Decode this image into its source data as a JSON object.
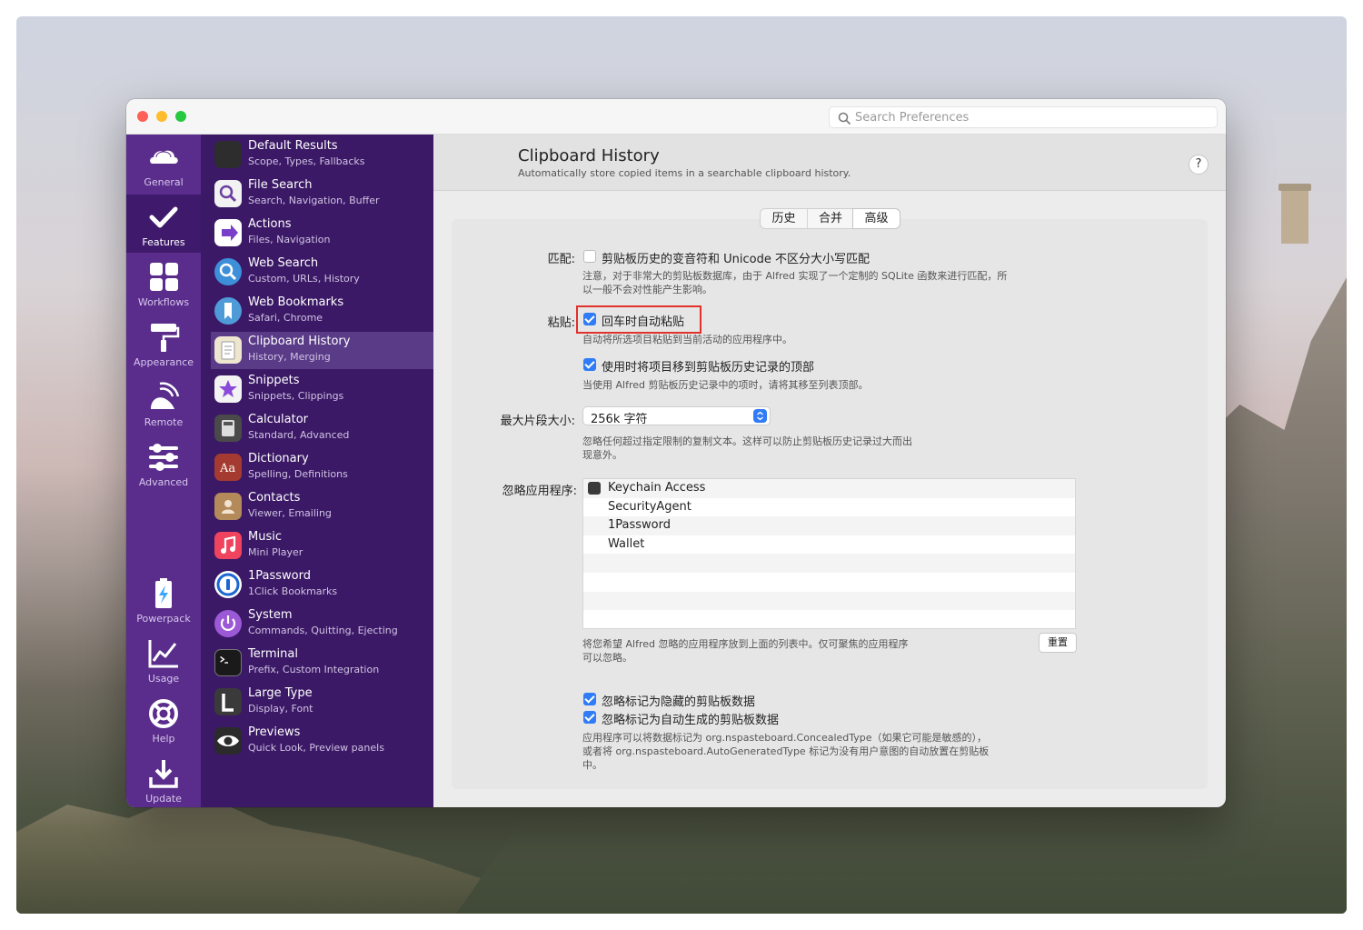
{
  "window": {
    "search_placeholder": "Search Preferences"
  },
  "rail": {
    "items": [
      {
        "label": "General",
        "icon": "cloud-hat-icon"
      },
      {
        "label": "Features",
        "icon": "checkmark-icon"
      },
      {
        "label": "Workflows",
        "icon": "grid-icon"
      },
      {
        "label": "Appearance",
        "icon": "paint-roller-icon"
      },
      {
        "label": "Remote",
        "icon": "remote-icon"
      },
      {
        "label": "Advanced",
        "icon": "sliders-icon"
      },
      {
        "label": "Powerpack",
        "icon": "battery-bolt-icon"
      },
      {
        "label": "Usage",
        "icon": "chart-line-icon"
      },
      {
        "label": "Help",
        "icon": "lifebuoy-icon"
      },
      {
        "label": "Update",
        "icon": "download-icon"
      }
    ]
  },
  "features": [
    {
      "title": "Default Results",
      "sub": "Scope, Types, Fallbacks",
      "color": "#2d2d2d"
    },
    {
      "title": "File Search",
      "sub": "Search, Navigation, Buffer",
      "color": "#f2f2f2"
    },
    {
      "title": "Actions",
      "sub": "Files, Navigation",
      "color": "#ffffff"
    },
    {
      "title": "Web Search",
      "sub": "Custom, URLs, History",
      "color": "#3d8fd9"
    },
    {
      "title": "Web Bookmarks",
      "sub": "Safari, Chrome",
      "color": "#4f9bd8"
    },
    {
      "title": "Clipboard History",
      "sub": "History, Merging",
      "color": "#efe6d0"
    },
    {
      "title": "Snippets",
      "sub": "Snippets, Clippings",
      "color": "#f3f3f3"
    },
    {
      "title": "Calculator",
      "sub": "Standard, Advanced",
      "color": "#4a4a4a"
    },
    {
      "title": "Dictionary",
      "sub": "Spelling, Definitions",
      "color": "#a53b30"
    },
    {
      "title": "Contacts",
      "sub": "Viewer, Emailing",
      "color": "#b48a5a"
    },
    {
      "title": "Music",
      "sub": "Mini Player",
      "color": "#f0435d"
    },
    {
      "title": "1Password",
      "sub": "1Click Bookmarks",
      "color": "#1b66d2"
    },
    {
      "title": "System",
      "sub": "Commands, Quitting, Ejecting",
      "color": "#9b59d6"
    },
    {
      "title": "Terminal",
      "sub": "Prefix, Custom Integration",
      "color": "#1a1a1a"
    },
    {
      "title": "Large Type",
      "sub": "Display, Font",
      "color": "#3a3a3a"
    },
    {
      "title": "Previews",
      "sub": "Quick Look, Preview panels",
      "color": "#2b2b2b"
    }
  ],
  "header": {
    "title": "Clipboard History",
    "subtitle": "Automatically store copied items in a searchable clipboard history.",
    "help": "?"
  },
  "tabs": [
    "历史",
    "合并",
    "高级"
  ],
  "settings": {
    "match_label": "匹配:",
    "match_option": "剪贴板历史的变音符和 Unicode 不区分大小写匹配",
    "match_note_1": "注意，对于非常大的剪贴板数据库，由于 Alfred 实现了一个定制的 SQLite 函数来进行匹配，所",
    "match_note_2": "以一般不会对性能产生影响。",
    "paste_label": "粘贴:",
    "paste_option": "回车时自动粘贴",
    "paste_note": "自动将所选项目粘贴到当前活动的应用程序中。",
    "move_option": "使用时将项目移到剪贴板历史记录的顶部",
    "move_note": "当使用 Alfred 剪贴板历史记录中的项时，请将其移至列表顶部。",
    "max_label": "最大片段大小:",
    "max_value": "256k 字符",
    "max_note_1": "忽略任何超过指定限制的复制文本。这样可以防止剪贴板历史记录过大而出",
    "max_note_2": "现意外。",
    "ignore_label": "忽略应用程序:",
    "ignore_apps": [
      "Keychain Access",
      "SecurityAgent",
      "1Password",
      "Wallet"
    ],
    "ignore_note_1": "将您希望 Alfred 忽略的应用程序放到上面的列表中。仅可聚焦的应用程序",
    "ignore_note_2": "可以忽略。",
    "reset": "重置",
    "concealed_option": "忽略标记为隐藏的剪贴板数据",
    "autogen_option": "忽略标记为自动生成的剪贴板数据",
    "bottom_note_1": "应用程序可以将数据标记为 org.nspasteboard.ConcealedType（如果它可能是敏感的），",
    "bottom_note_2": "或者将 org.nspasteboard.AutoGeneratedType 标记为没有用户意图的自动放置在剪贴板",
    "bottom_note_3": "中。"
  },
  "colors": {
    "rail": "#5a2d8c",
    "features": "#3b1966",
    "accent": "#2f7cf6",
    "highlight": "#e0312b"
  }
}
